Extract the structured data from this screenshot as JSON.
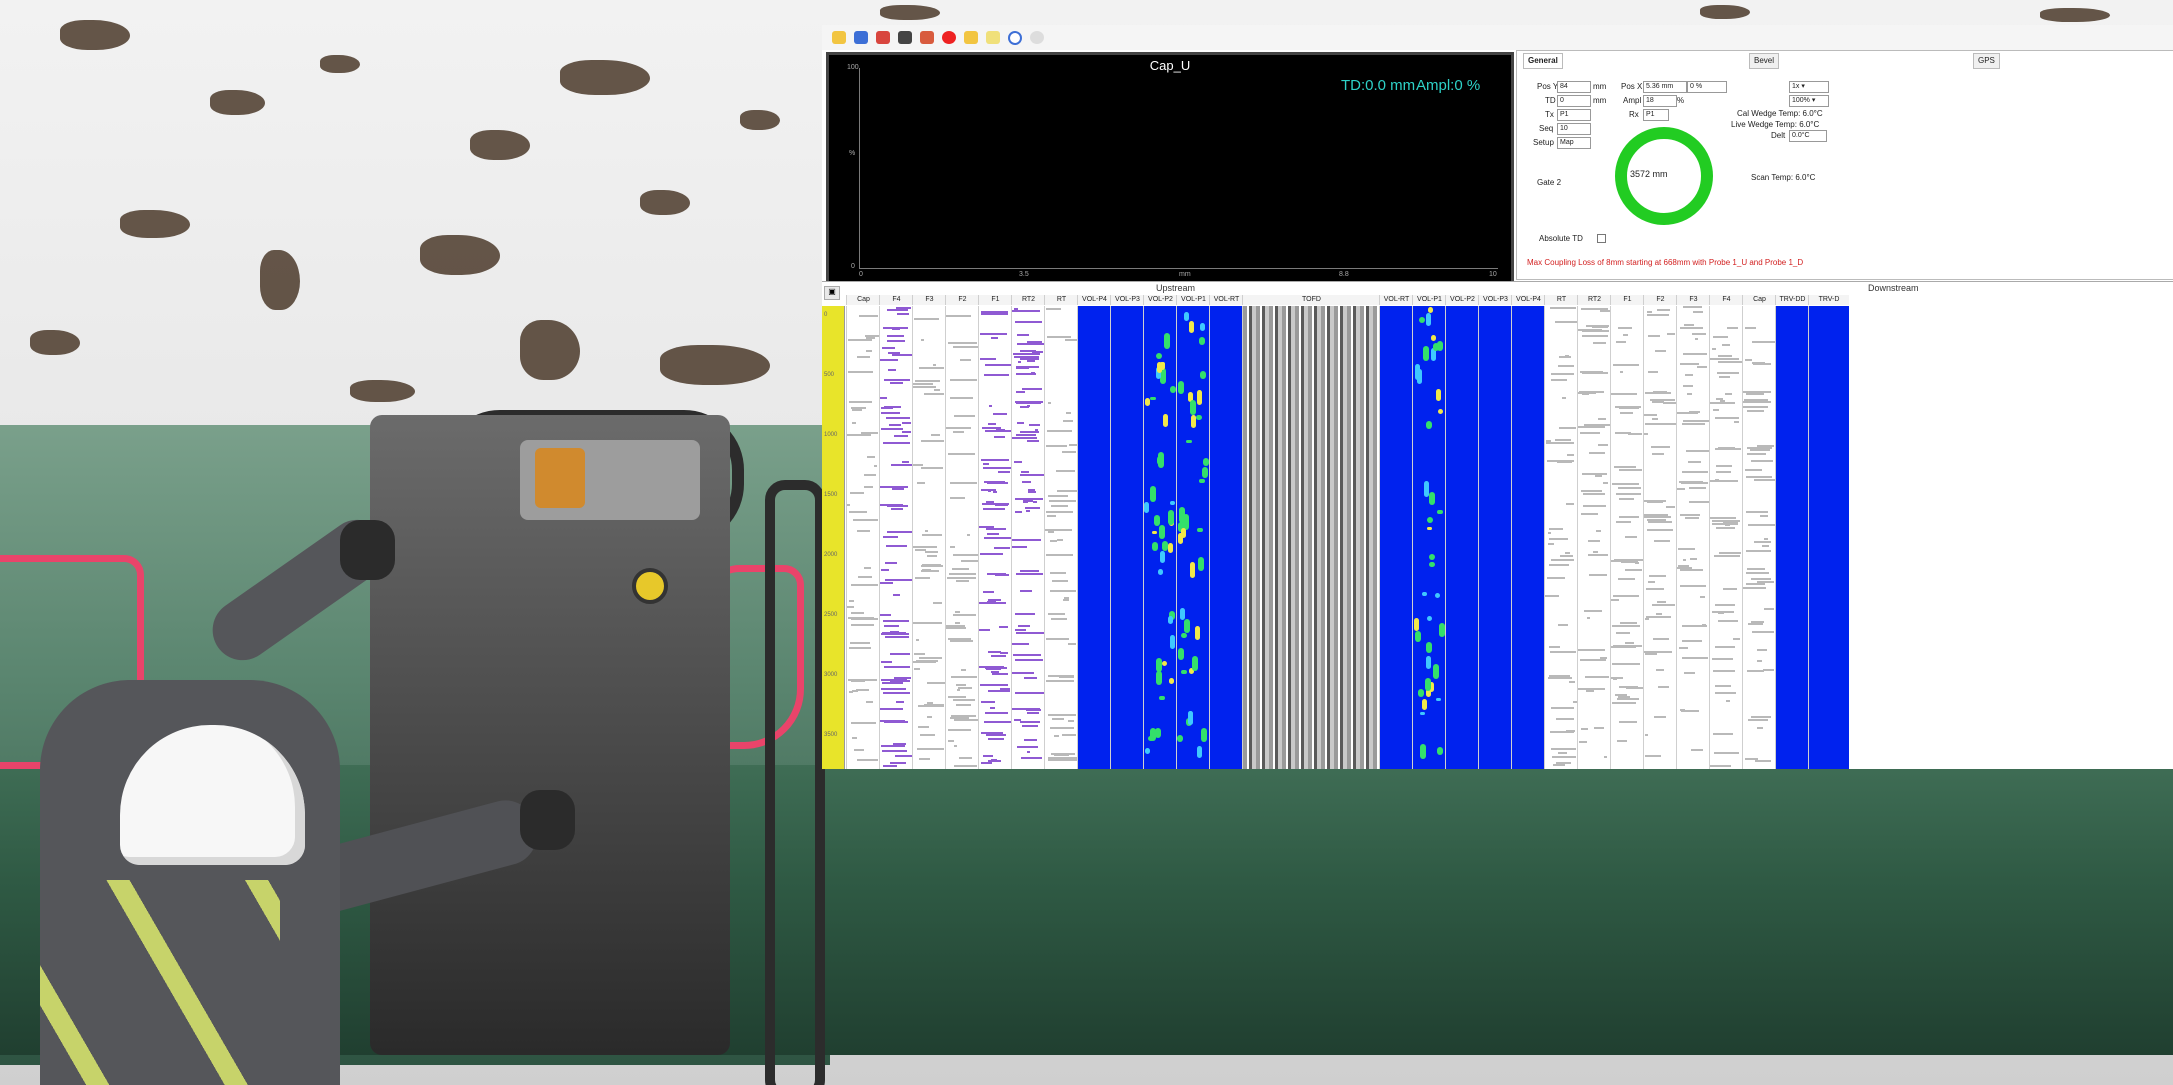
{
  "ascan": {
    "title": "Cap_U",
    "td": "TD:0.0 mm",
    "ampl": "Ampl:0 %",
    "y_ticks": [
      "100",
      "%",
      "0"
    ],
    "x_ticks": [
      "0",
      "3.5",
      "mm",
      "8.8",
      "10"
    ]
  },
  "params": {
    "tabs": [
      "General",
      "Bevel",
      "GPS"
    ],
    "fields": {
      "pos_y_label": "Pos Y",
      "pos_y_value": "84",
      "pos_y_unit": "mm",
      "td_label": "TD",
      "td_value": "0",
      "td_unit": "mm",
      "tx_label": "Tx",
      "tx_value": "P1",
      "seq_label": "Seq",
      "seq_value": "10",
      "setup_label": "Setup",
      "setup_value": "Map",
      "pos_x_label": "Pos X",
      "pos_x_value": "5.36 mm",
      "pos_x_pct": "0 %",
      "ampl_label": "Ampl",
      "ampl_value": "18",
      "ampl_unit": "%",
      "rx_label": "Rx",
      "rx_value": "P1",
      "select1": "1x",
      "select2": "100%",
      "cal_wedge": "Cal Wedge Temp: 6.0°C",
      "live_wedge": "Live Wedge Temp: 6.0°C",
      "delta_label": "Delt",
      "delta_value": "0.0°C",
      "gate_label": "Gate 2",
      "scan_temp": "Scan Temp: 6.0°C",
      "absolute_td": "Absolute TD",
      "ring_value": "3572 mm"
    },
    "warning": "Max Coupling Loss of 8mm starting at 668mm with Probe 1_U and Probe 1_D",
    "ring_color": "#22cc22"
  },
  "strips": {
    "upstream_label": "Upstream",
    "downstream_label": "Downstream",
    "columns": [
      "Cap",
      "F4",
      "F3",
      "F2",
      "F1",
      "RT2",
      "RT",
      "VOL-P4",
      "VOL-P3",
      "VOL-P2",
      "VOL-P1",
      "VOL-RT",
      "TOFD",
      "VOL-RT",
      "VOL-P1",
      "VOL-P2",
      "VOL-P3",
      "VOL-P4",
      "RT",
      "RT2",
      "F1",
      "F2",
      "F3",
      "F4",
      "Cap",
      "TRV-DD",
      "TRV-D"
    ],
    "ruler_ticks": [
      "0",
      "500",
      "1000",
      "1500",
      "2000",
      "2500",
      "3000",
      "3500"
    ]
  },
  "toolbar": {
    "icons": [
      "open-icon",
      "save-icon",
      "print-icon",
      "scan-icon",
      "undo-icon",
      "stop-icon",
      "folder-icon",
      "note-icon",
      "refresh-icon",
      "help-icon"
    ]
  }
}
